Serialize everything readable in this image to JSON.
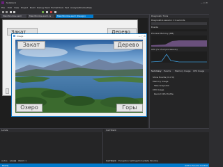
{
  "ide": {
    "titlebar_text": "Solution1",
    "menu": [
      "File",
      "Edit",
      "View",
      "Project",
      "Build",
      "Debug",
      "Team",
      "Format",
      "Tools",
      "Test",
      "Analyze",
      "Window",
      "Help"
    ],
    "doc_tabs": [
      "MainWindow.xaml",
      "MainWindow.xaml.cs",
      "MainWindow.xaml (Design)"
    ],
    "statusbar_text": "Ready",
    "statusbar_right": "Add to Source Control"
  },
  "back_window": {
    "btn_top_left": "Закат",
    "btn_top_right": "Дерево"
  },
  "app_window": {
    "title": "Image",
    "btn_top_left": "Закат",
    "btn_top_right": "Дерево",
    "btn_bottom_left": "Озеро",
    "btn_bottom_right": "Горы"
  },
  "diagnostic": {
    "title": "Diagnostic Tools",
    "session": "Diagnostics session: 11 seconds",
    "events_section": "Events",
    "memory_section": "Process Memory (MB)",
    "cpu_section": "CPU (% of all processors)",
    "tabs": [
      "Summary",
      "Events",
      "Memory Usage",
      "CPU Usage"
    ],
    "items": [
      "Show Events (0 of 0)",
      "Memory Usage",
      "Take Snapshot",
      "CPU Usage",
      "Record CPU Profile"
    ]
  },
  "bottom": {
    "left_title": "Locals",
    "right_title": "Call Stack",
    "left_tabs": [
      "Autos",
      "Locals",
      "Watch 1"
    ],
    "right_tabs": [
      "Call Stack",
      "Exception Settings",
      "Immediate Window"
    ]
  },
  "colors": {
    "accent": "#007acc",
    "ide_bg": "#2d2d30"
  }
}
